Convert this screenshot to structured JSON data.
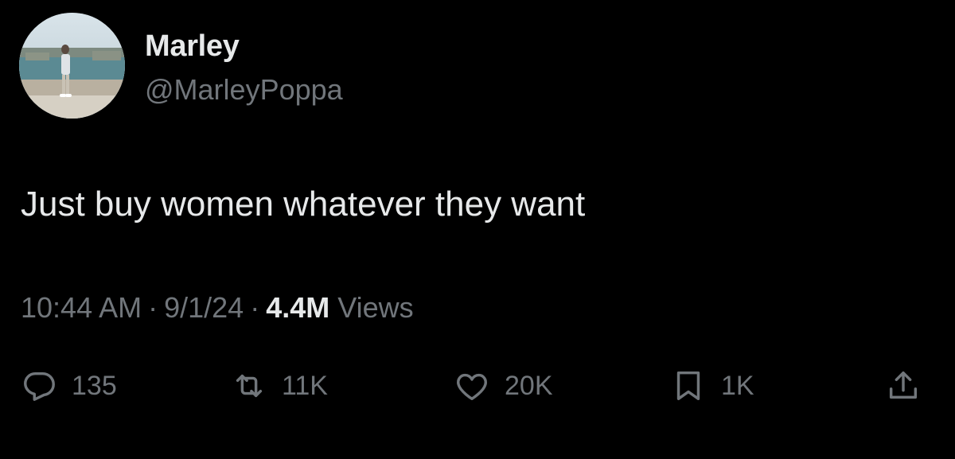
{
  "author": {
    "display_name": "Marley",
    "handle": "@MarleyPoppa",
    "avatar_icon": "profile-photo"
  },
  "tweet": {
    "text": "Just buy women whatever they want",
    "time": "10:44 AM",
    "date": "9/1/24",
    "separator": "·",
    "views_count": "4.4M",
    "views_label": "Views"
  },
  "actions": {
    "reply": {
      "icon": "reply-icon",
      "count": "135"
    },
    "retweet": {
      "icon": "retweet-icon",
      "count": "11K"
    },
    "like": {
      "icon": "heart-icon",
      "count": "20K"
    },
    "bookmark": {
      "icon": "bookmark-icon",
      "count": "1K"
    },
    "share": {
      "icon": "share-icon"
    }
  },
  "colors": {
    "background": "#000000",
    "primary_text": "#e7e9ea",
    "secondary_text": "#71767b"
  }
}
